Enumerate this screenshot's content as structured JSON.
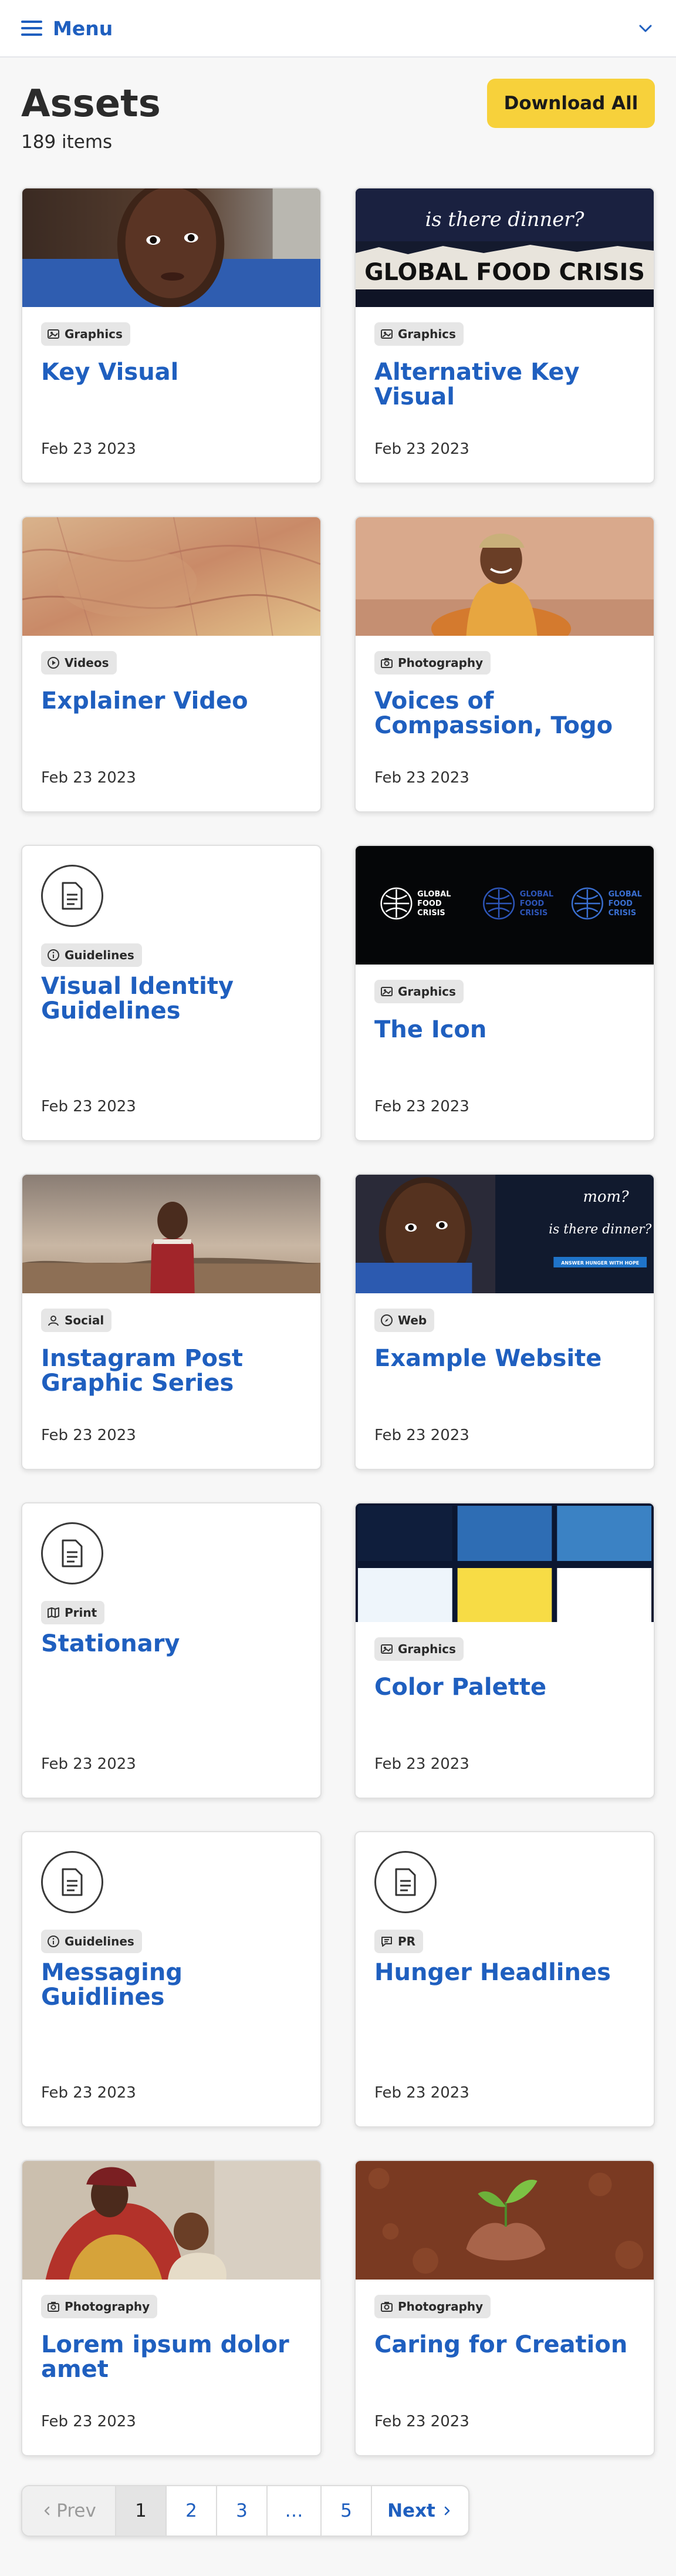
{
  "header": {
    "menu_label": "Menu"
  },
  "page": {
    "title": "Assets",
    "item_count": "189 items",
    "download_label": "Download All"
  },
  "assets": [
    {
      "category": "Graphics",
      "category_icon": "image-icon",
      "title": "Key Visual",
      "date": "Feb 23 2023",
      "thumb": "child-closeup-photo"
    },
    {
      "category": "Graphics",
      "category_icon": "image-icon",
      "title": "Alternative Key Visual",
      "date": "Feb 23 2023",
      "thumb": "global-food-crisis-banner",
      "thumb_text": {
        "handwriting": "is there dinner?",
        "banner": "GLOBAL FOOD CRISIS"
      }
    },
    {
      "category": "Videos",
      "category_icon": "play-icon",
      "title": "Explainer Video",
      "date": "Feb 23 2023",
      "thumb": "world-map-photo"
    },
    {
      "category": "Photography",
      "category_icon": "camera-icon",
      "title": "Voices of Compassion, Togo",
      "date": "Feb 23 2023",
      "thumb": "woman-smiling-photo"
    },
    {
      "category": "Guidelines",
      "category_icon": "info-icon",
      "title": "Visual Identity Guidelines",
      "date": "Feb 23 2023",
      "thumb": "document-icon"
    },
    {
      "category": "Graphics",
      "category_icon": "image-icon",
      "title": "The Icon",
      "date": "Feb 23 2023",
      "thumb": "global-food-crisis-logos",
      "thumb_text": {
        "logo_line1": "GLOBAL",
        "logo_line2": "FOOD",
        "logo_line3": "CRISIS"
      }
    },
    {
      "category": "Social",
      "category_icon": "user-icon",
      "title": "Instagram Post Graphic Series",
      "date": "Feb 23 2023",
      "thumb": "boy-red-sweater-photo"
    },
    {
      "category": "Web",
      "category_icon": "compass-icon",
      "title": "Example Website",
      "date": "Feb 23 2023",
      "thumb": "website-hero-photo",
      "thumb_text": {
        "line1": "mom?",
        "line2": "is there dinner?",
        "strip": "ANSWER HUNGER WITH HOPE"
      }
    },
    {
      "category": "Print",
      "category_icon": "map-icon",
      "title": "Stationary",
      "date": "Feb 23 2023",
      "thumb": "document-icon"
    },
    {
      "category": "Graphics",
      "category_icon": "image-icon",
      "title": "Color Palette",
      "date": "Feb 23 2023",
      "thumb": "color-palette-swatches",
      "swatches": [
        "#0f1e3c",
        "#2e6db4",
        "#3b82c4",
        "#eef5fb",
        "#f7dc45",
        "#ffffff"
      ]
    },
    {
      "category": "Guidelines",
      "category_icon": "info-icon",
      "title": "Messaging Guidlines",
      "date": "Feb 23 2023",
      "thumb": "document-icon"
    },
    {
      "category": "PR",
      "category_icon": "chat-icon",
      "title": "Hunger Headlines",
      "date": "Feb 23 2023",
      "thumb": "document-icon"
    },
    {
      "category": "Photography",
      "category_icon": "camera-icon",
      "title": "Lorem ipsum dolor amet",
      "date": "Feb 23 2023",
      "thumb": "mother-child-photo"
    },
    {
      "category": "Photography",
      "category_icon": "camera-icon",
      "title": "Caring for Creation",
      "date": "Feb 23 2023",
      "thumb": "hands-seedling-photo"
    }
  ],
  "pagination": {
    "prev": "Prev",
    "pages": [
      "1",
      "2",
      "3",
      "…",
      "5"
    ],
    "current": "1",
    "next": "Next"
  },
  "colors": {
    "accent": "#1f5fbf",
    "button": "#f7d13b",
    "badge_bg": "#e6e6e6"
  }
}
